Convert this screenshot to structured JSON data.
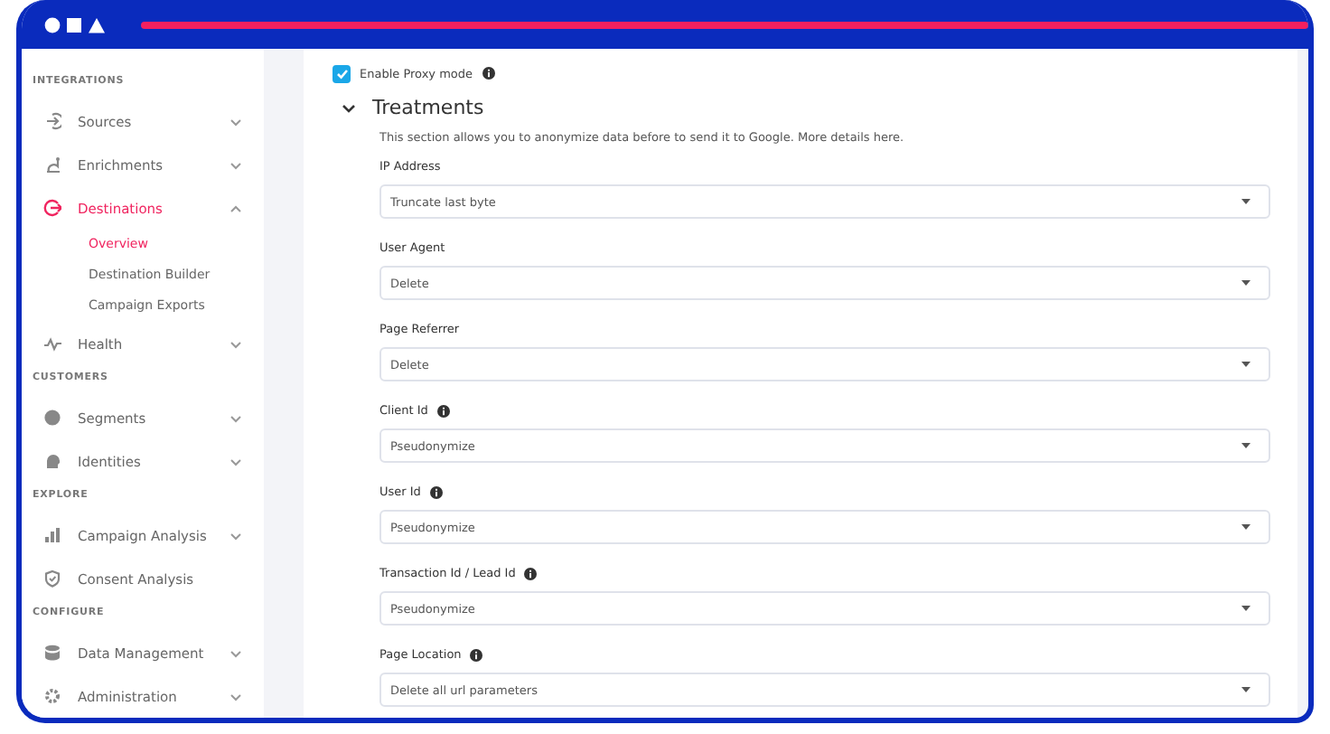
{
  "sidebar": {
    "sections": [
      {
        "heading": "INTEGRATIONS",
        "items": [
          {
            "label": "Sources",
            "kind": "group",
            "selected": false,
            "expanded": false
          },
          {
            "label": "Enrichments",
            "kind": "group",
            "selected": false,
            "expanded": false
          },
          {
            "label": "Destinations",
            "kind": "group",
            "selected": true,
            "expanded": true,
            "children": [
              {
                "label": "Overview",
                "selected": true
              },
              {
                "label": "Destination Builder",
                "selected": false
              },
              {
                "label": "Campaign Exports",
                "selected": false
              }
            ]
          },
          {
            "label": "Health",
            "kind": "group",
            "selected": false,
            "expanded": false
          }
        ]
      },
      {
        "heading": "CUSTOMERS",
        "items": [
          {
            "label": "Segments",
            "kind": "group",
            "selected": false,
            "expanded": false
          },
          {
            "label": "Identities",
            "kind": "group",
            "selected": false,
            "expanded": false
          }
        ]
      },
      {
        "heading": "EXPLORE",
        "items": [
          {
            "label": "Campaign Analysis",
            "kind": "group",
            "selected": false,
            "expanded": false
          },
          {
            "label": "Consent Analysis",
            "kind": "link",
            "selected": false
          }
        ]
      },
      {
        "heading": "CONFIGURE",
        "items": [
          {
            "label": "Data Management",
            "kind": "group",
            "selected": false,
            "expanded": false
          },
          {
            "label": "Administration",
            "kind": "group",
            "selected": false,
            "expanded": false
          }
        ]
      }
    ]
  },
  "proxy": {
    "label": "Enable Proxy mode",
    "checked": true,
    "info": true
  },
  "treatments": {
    "title": "Treatments",
    "expanded": true,
    "description": "This section allows you to anonymize data before to send it to Google. More details here.",
    "fields": [
      {
        "label": "IP Address",
        "info": false,
        "value": "Truncate last byte"
      },
      {
        "label": "User Agent",
        "info": false,
        "value": "Delete"
      },
      {
        "label": "Page Referrer",
        "info": false,
        "value": "Delete"
      },
      {
        "label": "Client Id",
        "info": true,
        "value": "Pseudonymize"
      },
      {
        "label": "User Id",
        "info": true,
        "value": "Pseudonymize"
      },
      {
        "label": "Transaction Id / Lead Id",
        "info": true,
        "value": "Pseudonymize"
      },
      {
        "label": "Page Location",
        "info": true,
        "value": "Delete all url parameters"
      }
    ]
  }
}
